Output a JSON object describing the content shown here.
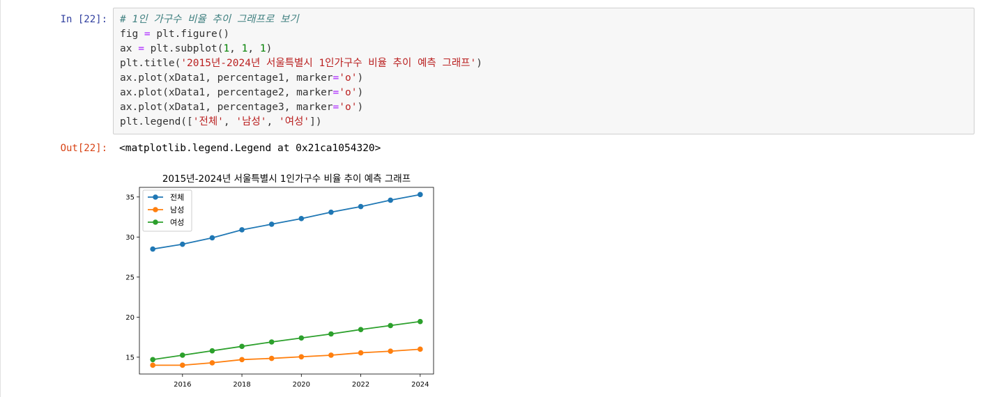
{
  "cell": {
    "in_prompt": "In [22]:",
    "out_prompt": "Out[22]:",
    "output_text": "<matplotlib.legend.Legend at 0x21ca1054320>",
    "code_lines": [
      [
        {
          "t": "# 1인 가구수 비율 추이 그래프로 보기",
          "c": "cm"
        }
      ],
      [
        {
          "t": "fig "
        },
        {
          "t": "=",
          "c": "op"
        },
        {
          "t": " plt.figure()"
        }
      ],
      [
        {
          "t": "ax "
        },
        {
          "t": "=",
          "c": "op"
        },
        {
          "t": " plt.subplot("
        },
        {
          "t": "1",
          "c": "num"
        },
        {
          "t": ", "
        },
        {
          "t": "1",
          "c": "num"
        },
        {
          "t": ", "
        },
        {
          "t": "1",
          "c": "num"
        },
        {
          "t": ")"
        }
      ],
      [
        {
          "t": "plt.title("
        },
        {
          "t": "'2015년-2024년 서울특별시 1인가구수 비율 추이 예측 그래프'",
          "c": "str"
        },
        {
          "t": ")"
        }
      ],
      [
        {
          "t": "ax.plot(xData1, percentage1, marker"
        },
        {
          "t": "=",
          "c": "op"
        },
        {
          "t": "'o'",
          "c": "str"
        },
        {
          "t": ")"
        }
      ],
      [
        {
          "t": "ax.plot(xData1, percentage2, marker"
        },
        {
          "t": "=",
          "c": "op"
        },
        {
          "t": "'o'",
          "c": "str"
        },
        {
          "t": ")"
        }
      ],
      [
        {
          "t": "ax.plot(xData1, percentage3, marker"
        },
        {
          "t": "=",
          "c": "op"
        },
        {
          "t": "'o'",
          "c": "str"
        },
        {
          "t": ")"
        }
      ],
      [
        {
          "t": "plt.legend(["
        },
        {
          "t": "'전체'",
          "c": "str"
        },
        {
          "t": ", "
        },
        {
          "t": "'남성'",
          "c": "str"
        },
        {
          "t": ", "
        },
        {
          "t": "'여성'",
          "c": "str"
        },
        {
          "t": "])"
        }
      ]
    ]
  },
  "chart_data": {
    "type": "line",
    "title": "2015년-2024년 서울특별시 1인가구수 비율 추이 예측 그래프",
    "xlabel": "",
    "ylabel": "",
    "x": [
      2015,
      2016,
      2017,
      2018,
      2019,
      2020,
      2021,
      2022,
      2023,
      2024
    ],
    "xlim": [
      2014.55,
      2024.45
    ],
    "ylim": [
      12.9,
      36.2
    ],
    "xticks": [
      2016,
      2018,
      2020,
      2022,
      2024
    ],
    "yticks": [
      15,
      20,
      25,
      30,
      35
    ],
    "grid": false,
    "legend_position": "upper left",
    "marker": "o",
    "series": [
      {
        "name": "전체",
        "color": "#1f77b4",
        "values": [
          28.5,
          29.1,
          29.9,
          30.9,
          31.6,
          32.3,
          33.1,
          33.8,
          34.6,
          35.3
        ]
      },
      {
        "name": "남성",
        "color": "#ff7f0e",
        "values": [
          14.0,
          14.0,
          14.3,
          14.7,
          14.85,
          15.05,
          15.25,
          15.55,
          15.75,
          16.0
        ]
      },
      {
        "name": "여성",
        "color": "#2ca02c",
        "values": [
          14.7,
          15.25,
          15.8,
          16.35,
          16.9,
          17.4,
          17.9,
          18.45,
          18.95,
          19.45
        ]
      }
    ]
  }
}
